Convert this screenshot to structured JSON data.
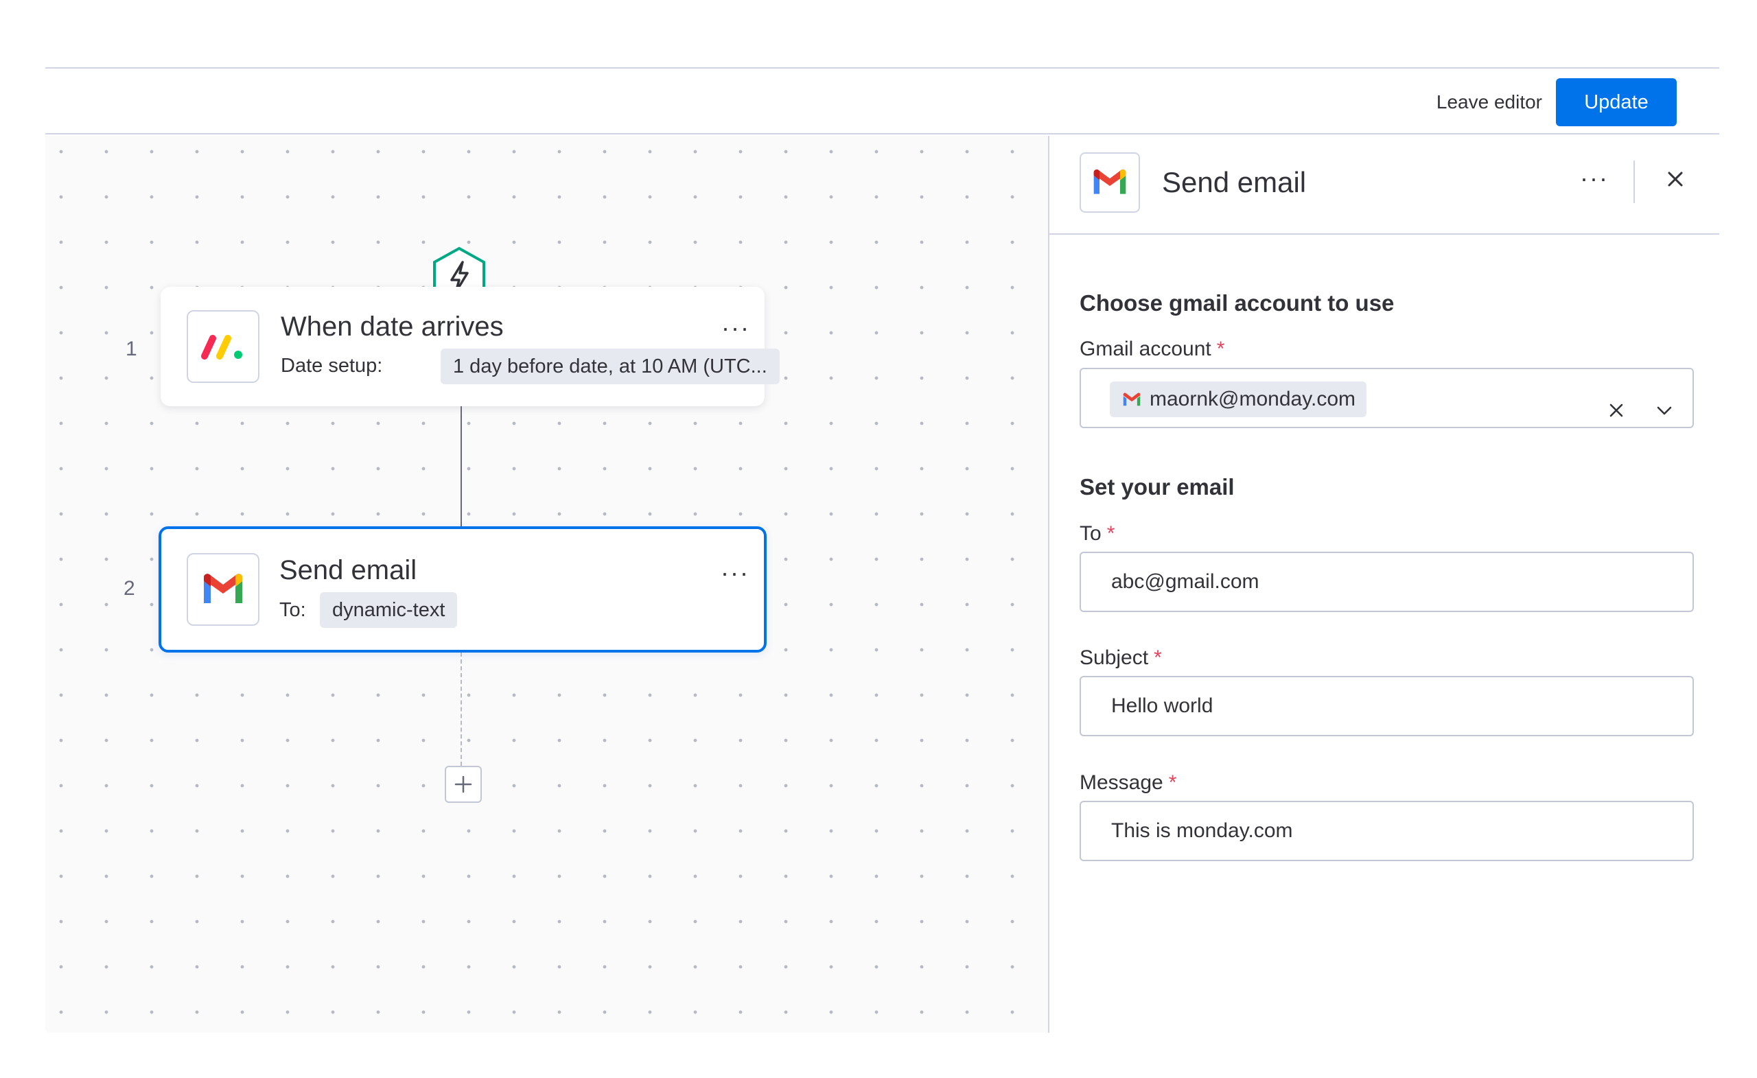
{
  "header": {
    "leave_editor_label": "Leave editor",
    "update_label": "Update"
  },
  "workflow": {
    "steps": [
      {
        "number": "1",
        "title": "When date arrives",
        "sub_label": "Date setup:",
        "chip": "1 day before date, at 10 AM (UTC...",
        "icon": "monday-logo-icon"
      },
      {
        "number": "2",
        "title": "Send email",
        "sub_label": "To:",
        "chip": "dynamic-text",
        "icon": "gmail-icon"
      }
    ],
    "trigger_icon": "lightning-icon",
    "add_icon": "plus-icon"
  },
  "panel": {
    "title": "Send email",
    "icon": "gmail-icon",
    "sections": {
      "account_title": "Choose gmail account to use",
      "email_title": "Set your email"
    },
    "fields": {
      "gmail_account": {
        "label": "Gmail account",
        "required": "*",
        "value": "maornk@monday.com"
      },
      "to": {
        "label": "To",
        "required": "*",
        "value": "abc@gmail.com"
      },
      "subject": {
        "label": "Subject",
        "required": "*",
        "value": "Hello world"
      },
      "message": {
        "label": "Message",
        "required": "*",
        "value": "This is monday.com"
      }
    }
  },
  "colors": {
    "accent": "#0073ea",
    "required": "#e2445c",
    "trigger": "#00a884"
  }
}
